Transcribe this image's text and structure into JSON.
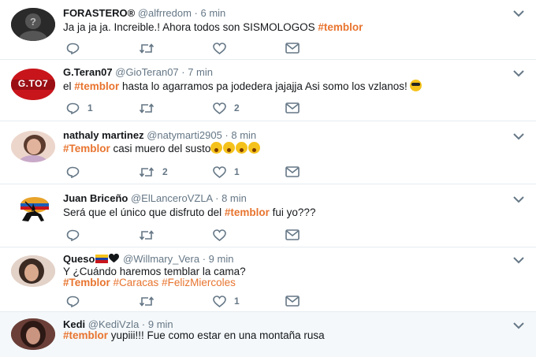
{
  "tweets": [
    {
      "name": "FORASTERO®",
      "handle": "@alfrredom",
      "time": "6 min",
      "text_a": "Ja ja ja ja. Increible.!  Ahora todos son SISMOLOGOS ",
      "tag": "#temblor",
      "reply_count": "",
      "rt_count": "",
      "like_count": ""
    },
    {
      "name": "G.Teran07",
      "handle": "@GioTeran07",
      "time": "7 min",
      "text_pre": "el ",
      "tag": "#temblor",
      "text_post": " hasta lo agarramos pa jodedera jajajja Asi somo los vzlanos! ",
      "avatar_label": "G.TO7",
      "reply_count": "1",
      "rt_count": "",
      "like_count": "2"
    },
    {
      "name": "nathaly martinez",
      "handle": "@natymarti2905",
      "time": "8 min",
      "tag": "#Temblor",
      "text_post": " casi muero del susto",
      "reply_count": "",
      "rt_count": "2",
      "like_count": "1"
    },
    {
      "name": "Juan Briceño",
      "handle": "@ElLanceroVZLA",
      "time": "8 min",
      "text_pre": "Será que el único que disfruto del ",
      "tag": "#temblor",
      "text_post": " fui yo???",
      "reply_count": "",
      "rt_count": "",
      "like_count": ""
    },
    {
      "name": "Queso",
      "handle": "@Willmary_Vera",
      "time": "9 min",
      "text_line1": "Y ¿Cuándo haremos temblar la cama?",
      "tags": [
        "#Temblor",
        "#Caracas",
        "#FelizMiercoles"
      ],
      "reply_count": "",
      "rt_count": "",
      "like_count": "1"
    },
    {
      "name": "Kedi",
      "handle": "@KediVzla",
      "time": "9 min",
      "tag": "#temblor",
      "text_post": " yupiii!!! Fue como estar en una montaña rusa"
    }
  ],
  "separator": " · ",
  "icons": {
    "reply": "reply-icon",
    "retweet": "retweet-icon",
    "like": "heart-icon",
    "dm": "envelope-icon",
    "menu": "chevron-down-icon"
  },
  "colors": {
    "hashtag": "#e8742f",
    "meta": "#657786",
    "icon": "#657786",
    "highlight_bg": "#f5f8fa"
  }
}
